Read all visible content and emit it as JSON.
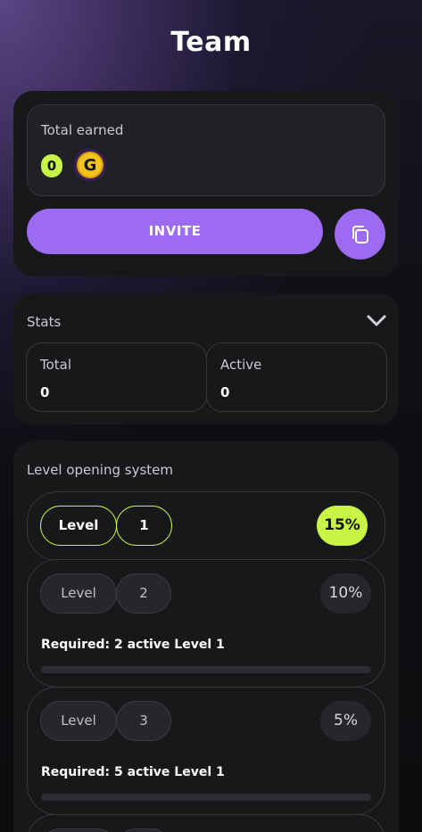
{
  "header": {
    "title": "Team"
  },
  "earned": {
    "label": "Total earned",
    "value": "0",
    "coin_letter": "G",
    "coin_icon": "coin-icon"
  },
  "actions": {
    "invite_label": "INVITE",
    "copy_icon": "copy-icon"
  },
  "stats": {
    "label": "Stats",
    "cards": [
      {
        "label": "Total",
        "value": "0"
      },
      {
        "label": "Active",
        "value": "0"
      }
    ]
  },
  "levels": {
    "label": "Level opening system",
    "items": [
      {
        "word": "Level",
        "number": "1",
        "percent": "15%",
        "active": true
      },
      {
        "word": "Level",
        "number": "2",
        "percent": "10%",
        "active": false,
        "requirement": "Required: 2 active Level 1",
        "progress": 0
      },
      {
        "word": "Level",
        "number": "3",
        "percent": "5%",
        "active": false,
        "requirement": "Required: 5 active Level 1",
        "progress": 0
      }
    ]
  },
  "colors": {
    "accent": "#9c6bf2",
    "lime": "#c8f545",
    "panel": "#17181a"
  }
}
